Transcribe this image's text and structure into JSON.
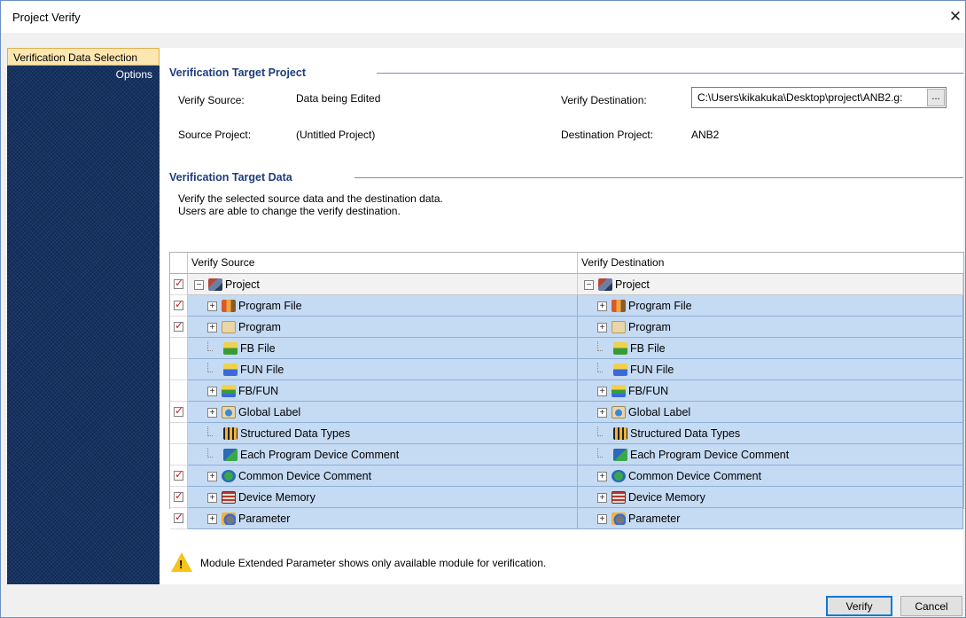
{
  "window": {
    "title": "Project Verify",
    "close_glyph": "✕"
  },
  "sidebar": {
    "items": [
      {
        "label": "Verification Data Selection",
        "active": true
      },
      {
        "label": "Options",
        "active": false
      }
    ]
  },
  "target_project": {
    "heading": "Verification Target Project",
    "verify_source_label": "Verify Source:",
    "verify_source_value": "Data being Edited",
    "source_project_label": "Source Project:",
    "source_project_value": "(Untitled Project)",
    "verify_destination_label": "Verify Destination:",
    "verify_destination_value": "C:\\Users\\kikakuka\\Desktop\\project\\ANB2.g:",
    "browse_label": "...",
    "destination_project_label": "Destination Project:",
    "destination_project_value": "ANB2"
  },
  "target_data": {
    "heading": "Verification Target Data",
    "description_line1": "Verify the selected source data and the destination data.",
    "description_line2": "Users are able to change the verify destination."
  },
  "grid": {
    "col_source": "Verify Source",
    "col_destination": "Verify Destination",
    "rows": [
      {
        "label": "Project",
        "icon": "project-icon",
        "checked": true,
        "expander": "minus",
        "level": 0
      },
      {
        "label": "Program File",
        "icon": "program-file-icon",
        "checked": true,
        "expander": "plus",
        "level": 1
      },
      {
        "label": "Program",
        "icon": "program-icon",
        "checked": true,
        "expander": "plus",
        "level": 1
      },
      {
        "label": "FB File",
        "icon": "fb-file-icon",
        "checked": false,
        "expander": "none",
        "level": 1
      },
      {
        "label": "FUN File",
        "icon": "fun-file-icon",
        "checked": false,
        "expander": "none",
        "level": 1
      },
      {
        "label": "FB/FUN",
        "icon": "fb-fun-icon",
        "checked": false,
        "expander": "plus",
        "level": 1
      },
      {
        "label": "Global Label",
        "icon": "global-label-icon",
        "checked": true,
        "expander": "plus",
        "level": 1
      },
      {
        "label": "Structured Data Types",
        "icon": "structured-data-icon",
        "checked": false,
        "expander": "none",
        "level": 1
      },
      {
        "label": "Each Program Device Comment",
        "icon": "device-comment-icon",
        "checked": false,
        "expander": "none",
        "level": 1
      },
      {
        "label": "Common Device Comment",
        "icon": "common-comment-icon",
        "checked": true,
        "expander": "plus",
        "level": 1
      },
      {
        "label": "Device Memory",
        "icon": "device-memory-icon",
        "checked": true,
        "expander": "plus",
        "level": 1
      },
      {
        "label": "Parameter",
        "icon": "parameter-icon",
        "checked": true,
        "expander": "plus",
        "level": 1
      }
    ]
  },
  "info": {
    "message": "Module Extended Parameter shows only available module for verification.",
    "warn_glyph": "!"
  },
  "buttons": {
    "verify": "Verify",
    "cancel": "Cancel"
  },
  "colors": {
    "accent": "#0078d7",
    "row_selected": "#c5daf3",
    "heading": "#1f3d7a",
    "check_mark": "#d21f1f",
    "sidebar_bg": "#0e2a58"
  }
}
